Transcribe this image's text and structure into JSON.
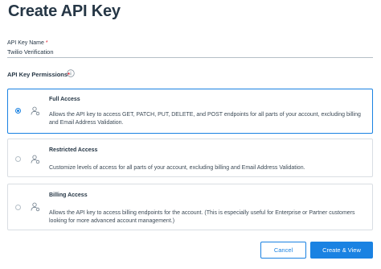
{
  "page": {
    "title": "Create API Key"
  },
  "name_field": {
    "label": "API Key Name",
    "required_mark": "*",
    "value": "Twilio Verification"
  },
  "permissions": {
    "label": "API Key Permissions",
    "required_mark": "*",
    "info_icon": "info-circle-icon",
    "options": [
      {
        "title": "Full Access",
        "description": "Allows the API key to access GET, PATCH, PUT, DELETE, and POST endpoints for all parts of your account, excluding billing and Email Address Validation.",
        "selected": true,
        "icon": "person-gear-icon"
      },
      {
        "title": "Restricted Access",
        "description": "Customize levels of access for all parts of your account, excluding billing and Email Address Validation.",
        "selected": false,
        "icon": "person-gear-icon"
      },
      {
        "title": "Billing Access",
        "description": "Allows the API key to access billing endpoints for the account. (This is especially useful for Enterprise or Partner customers looking for more advanced account management.)",
        "selected": false,
        "icon": "person-gear-icon"
      }
    ]
  },
  "actions": {
    "cancel_label": "Cancel",
    "create_label": "Create & View"
  },
  "colors": {
    "accent": "#1a82e2",
    "text": "#263746",
    "required": "#e21c2c",
    "border": "#d9dee3"
  }
}
